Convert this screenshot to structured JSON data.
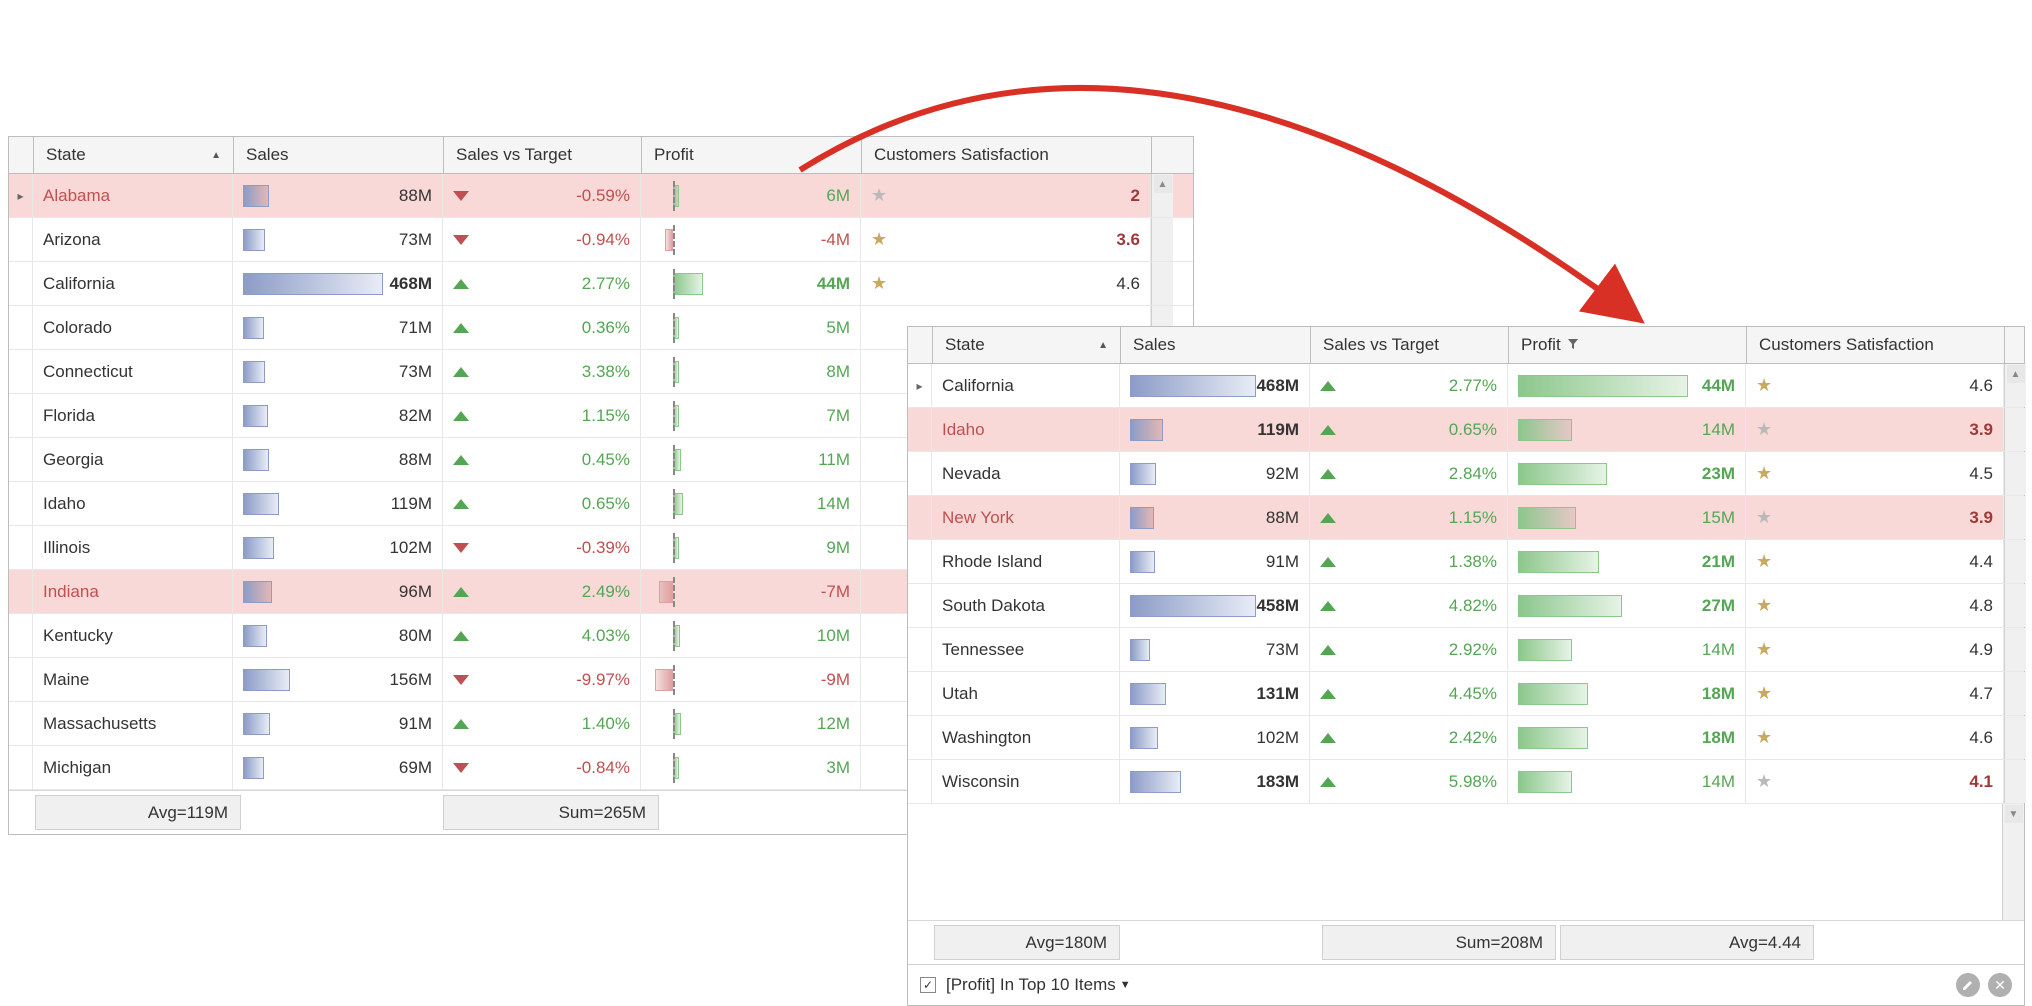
{
  "left": {
    "headers": {
      "state": "State",
      "sales": "Sales",
      "svt": "Sales vs Target",
      "profit": "Profit",
      "cust": "Customers Satisfaction"
    },
    "sales_max": 468,
    "profit_max": 44,
    "rows": [
      {
        "ind": true,
        "sel": true,
        "red": true,
        "state": "Alabama",
        "sales": "88M",
        "salesN": 88,
        "svtDir": "down",
        "svt": "-0.59%",
        "profitN": 6,
        "profit": "6M",
        "pcolor": "green",
        "star": "grey",
        "cust": "2",
        "custRed": true
      },
      {
        "state": "Arizona",
        "sales": "73M",
        "salesN": 73,
        "svtDir": "down",
        "svt": "-0.94%",
        "profitN": -4,
        "profit": "-4M",
        "pcolor": "redc",
        "star": "gold",
        "cust": "3.6",
        "custRed": true
      },
      {
        "state": "California",
        "sales": "468M",
        "salesN": 468,
        "bold": true,
        "svtDir": "up",
        "svt": "2.77%",
        "profitN": 44,
        "profit": "44M",
        "pbold": true,
        "pcolor": "green",
        "star": "gold",
        "cust": "4.6"
      },
      {
        "state": "Colorado",
        "sales": "71M",
        "salesN": 71,
        "svtDir": "up",
        "svt": "0.36%",
        "profitN": 5,
        "profit": "5M",
        "pcolor": "green",
        "hideStar": true,
        "cust": ""
      },
      {
        "state": "Connecticut",
        "sales": "73M",
        "salesN": 73,
        "svtDir": "up",
        "svt": "3.38%",
        "profitN": 8,
        "profit": "8M",
        "pcolor": "green",
        "hideStar": true,
        "cust": ""
      },
      {
        "state": "Florida",
        "sales": "82M",
        "salesN": 82,
        "svtDir": "up",
        "svt": "1.15%",
        "profitN": 7,
        "profit": "7M",
        "pcolor": "green",
        "hideStar": true,
        "cust": ""
      },
      {
        "state": "Georgia",
        "sales": "88M",
        "salesN": 88,
        "svtDir": "up",
        "svt": "0.45%",
        "profitN": 11,
        "profit": "11M",
        "pcolor": "green",
        "hideStar": true,
        "cust": ""
      },
      {
        "state": "Idaho",
        "sales": "119M",
        "salesN": 119,
        "svtDir": "up",
        "svt": "0.65%",
        "profitN": 14,
        "profit": "14M",
        "pcolor": "green",
        "hideStar": true,
        "cust": ""
      },
      {
        "state": "Illinois",
        "sales": "102M",
        "salesN": 102,
        "svtDir": "down",
        "svt": "-0.39%",
        "profitN": 9,
        "profit": "9M",
        "pcolor": "green",
        "hideStar": true,
        "cust": ""
      },
      {
        "sel": true,
        "red": true,
        "state": "Indiana",
        "sales": "96M",
        "salesN": 96,
        "svtDir": "up",
        "svt": "2.49%",
        "profitN": -7,
        "profit": "-7M",
        "pcolor": "redc",
        "hideStar": true,
        "cust": ""
      },
      {
        "state": "Kentucky",
        "sales": "80M",
        "salesN": 80,
        "svtDir": "up",
        "svt": "4.03%",
        "profitN": 10,
        "profit": "10M",
        "pcolor": "green",
        "hideStar": true,
        "cust": ""
      },
      {
        "state": "Maine",
        "sales": "156M",
        "salesN": 156,
        "svtDir": "down",
        "svt": "-9.97%",
        "profitN": -9,
        "profit": "-9M",
        "pcolor": "redc",
        "hideStar": true,
        "cust": ""
      },
      {
        "state": "Massachusetts",
        "sales": "91M",
        "salesN": 91,
        "svtDir": "up",
        "svt": "1.40%",
        "profitN": 12,
        "profit": "12M",
        "pcolor": "green",
        "hideStar": true,
        "cust": ""
      },
      {
        "state": "Michigan",
        "sales": "69M",
        "salesN": 69,
        "svtDir": "down",
        "svt": "-0.84%",
        "profitN": 3,
        "profit": "3M",
        "pcolor": "green",
        "hideStar": true,
        "cust": ""
      }
    ],
    "footer": {
      "sales": "Avg=119M",
      "profit": "Sum=265M"
    }
  },
  "right": {
    "headers": {
      "state": "State",
      "sales": "Sales",
      "svt": "Sales vs Target",
      "profit": "Profit",
      "cust": "Customers Satisfaction"
    },
    "sales_max": 468,
    "profit_max": 44,
    "rows": [
      {
        "ind": true,
        "state": "California",
        "sales": "468M",
        "salesN": 468,
        "bold": true,
        "svtDir": "up",
        "svt": "2.77%",
        "profitN": 44,
        "profit": "44M",
        "pbold": true,
        "star": "gold",
        "cust": "4.6"
      },
      {
        "sel": true,
        "red": true,
        "state": "Idaho",
        "sales": "119M",
        "salesN": 119,
        "bold": true,
        "svtDir": "up",
        "svt": "0.65%",
        "profitN": 14,
        "profit": "14M",
        "star": "grey",
        "cust": "3.9",
        "custRed": true
      },
      {
        "state": "Nevada",
        "sales": "92M",
        "salesN": 92,
        "svtDir": "up",
        "svt": "2.84%",
        "profitN": 23,
        "profit": "23M",
        "pbold": true,
        "star": "gold",
        "cust": "4.5"
      },
      {
        "sel": true,
        "red": true,
        "state": "New York",
        "sales": "88M",
        "salesN": 88,
        "svtDir": "up",
        "svt": "1.15%",
        "profitN": 15,
        "profit": "15M",
        "star": "grey",
        "cust": "3.9",
        "custRed": true
      },
      {
        "state": "Rhode Island",
        "sales": "91M",
        "salesN": 91,
        "svtDir": "up",
        "svt": "1.38%",
        "profitN": 21,
        "profit": "21M",
        "pbold": true,
        "star": "gold",
        "cust": "4.4"
      },
      {
        "state": "South Dakota",
        "sales": "458M",
        "salesN": 458,
        "bold": true,
        "svtDir": "up",
        "svt": "4.82%",
        "profitN": 27,
        "profit": "27M",
        "pbold": true,
        "star": "gold",
        "cust": "4.8"
      },
      {
        "state": "Tennessee",
        "sales": "73M",
        "salesN": 73,
        "svtDir": "up",
        "svt": "2.92%",
        "profitN": 14,
        "profit": "14M",
        "star": "gold",
        "cust": "4.9"
      },
      {
        "state": "Utah",
        "sales": "131M",
        "salesN": 131,
        "bold": true,
        "svtDir": "up",
        "svt": "4.45%",
        "profitN": 18,
        "profit": "18M",
        "pbold": true,
        "star": "gold",
        "cust": "4.7"
      },
      {
        "state": "Washington",
        "sales": "102M",
        "salesN": 102,
        "svtDir": "up",
        "svt": "2.42%",
        "profitN": 18,
        "profit": "18M",
        "pbold": true,
        "star": "gold",
        "cust": "4.6"
      },
      {
        "state": "Wisconsin",
        "sales": "183M",
        "salesN": 183,
        "bold": true,
        "svtDir": "up",
        "svt": "5.98%",
        "profitN": 14,
        "profit": "14M",
        "star": "grey",
        "cust": "4.1",
        "custRed": true
      }
    ],
    "footer": {
      "sales": "Avg=180M",
      "profit": "Sum=208M",
      "cust": "Avg=4.44"
    },
    "filter": "[Profit] In Top 10 Items"
  }
}
